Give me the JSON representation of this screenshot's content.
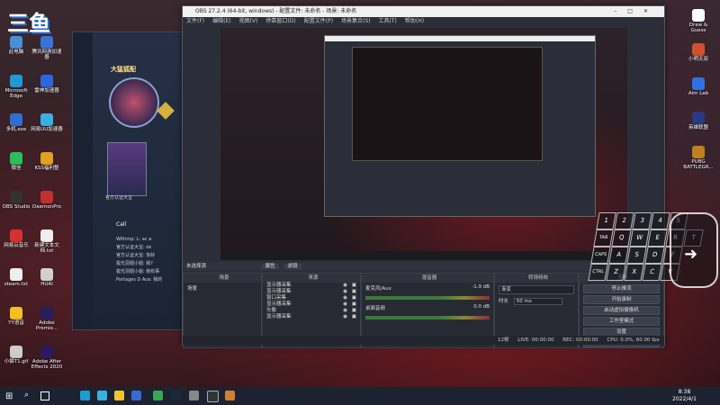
{
  "desktop_icons_left": [
    {
      "label": "此电脑",
      "color": "#4a8fd6"
    },
    {
      "label": "Microsoft Edge",
      "color": "#1e9bd6"
    },
    {
      "label": "多机.exe",
      "color": "#2f6fd0"
    },
    {
      "label": "微信",
      "color": "#2cbe5c"
    },
    {
      "label": "OBS Studio",
      "color": "#333"
    },
    {
      "label": "网易云音乐",
      "color": "#d8302e"
    },
    {
      "label": "steam.txt",
      "color": "#eee"
    },
    {
      "label": "YY语音",
      "color": "#f3c020"
    },
    {
      "label": "小猫T1.gif",
      "color": "#ccc"
    }
  ],
  "desktop_icons_col2": [
    {
      "label": "腾讯网游加速器",
      "color": "#3a72d8"
    },
    {
      "label": "雷神加速器",
      "color": "#2b66e0"
    },
    {
      "label": "网易UU加速器",
      "color": "#3ab0e0"
    },
    {
      "label": "KSS福利整",
      "color": "#e0a020"
    },
    {
      "label": "DaemonPro",
      "color": "#c03030"
    },
    {
      "label": "新建文本文档.txt",
      "color": "#eee"
    },
    {
      "label": "HUAI",
      "color": "#d0d0d0"
    },
    {
      "label": "Adobe Premie...",
      "color": "#2a1b5e"
    },
    {
      "label": "Adobe After Effects 2020",
      "color": "#2a1b5e"
    }
  ],
  "desktop_icons_right": [
    {
      "label": "Draw & Guess",
      "color": "#ffffff"
    },
    {
      "label": "小明无双",
      "color": "#d05030"
    },
    {
      "label": "Aim Lab",
      "color": "#3070e0"
    },
    {
      "label": "英雄联盟",
      "color": "#2a3a80"
    },
    {
      "label": "PUBG BATTLEGR...",
      "color": "#c08020"
    }
  ],
  "obs": {
    "title": "OBS 27.2.4 (64-bit, windows) - 配置文件: 未命名 - 场景: 未命名",
    "menu": [
      "文件(F)",
      "编辑(E)",
      "视图(V)",
      "停靠窗口(D)",
      "配置文件(P)",
      "场景集合(S)",
      "工具(T)",
      "帮助(H)"
    ],
    "source_toolbar": [
      "属性",
      "滤镜"
    ],
    "docks": {
      "scenes": {
        "header": "场景",
        "items": [
          "场景"
        ]
      },
      "sources": {
        "header": "来源",
        "items": [
          "显示器采集",
          "显示器采集",
          "窗口采集",
          "显示器采集",
          "头像",
          "显示器采集"
        ]
      },
      "mixer": {
        "header": "混音器",
        "tracks": [
          {
            "name": "麦克风/Aux",
            "db": "-1.9 dB"
          },
          {
            "name": "桌面音频",
            "db": "0.0 dB"
          }
        ]
      },
      "transitions": {
        "header": "转场特效",
        "type": "渐变",
        "duration_label": "时长",
        "duration": "50 ms"
      },
      "controls": {
        "header": "控件",
        "buttons": [
          "停止推流",
          "开始录制",
          "启动虚拟摄像机",
          "工作室模式",
          "设置",
          "退出"
        ]
      }
    },
    "no_source_msg": "未选择源",
    "status": {
      "live": "LIVE: 00:00:00",
      "rec": "REC: 00:00:00",
      "cpu": "CPU: 0.0%, 60.00 fps",
      "dropped": "12帧"
    }
  },
  "bgapp": {
    "title": "大猛狐配",
    "tag": "官方认证大宝",
    "chat_title": "Call",
    "chat_lines": [
      "Withmp: L: ac a",
      "官方认证大宝: ok",
      "官方认证大宝: 你好",
      "拔光羽翅小姐: 我?",
      "拔光羽翅小姐: 我有事",
      "Portages D Ace: 我的"
    ]
  },
  "taskbar": {
    "time": "8:38",
    "date": "2022/4/1"
  },
  "keys": [
    [
      "1",
      "2",
      "3",
      "4",
      "5"
    ],
    [
      "TAB",
      "Q",
      "W",
      "E",
      "R",
      "T"
    ],
    [
      "CAPS",
      "A",
      "S",
      "D",
      "F"
    ],
    [
      "CTRL",
      "Z",
      "X",
      "C",
      "V"
    ]
  ],
  "colors": {
    "obs_bg": "#2b2e38",
    "accent": "#3a7a3a"
  }
}
